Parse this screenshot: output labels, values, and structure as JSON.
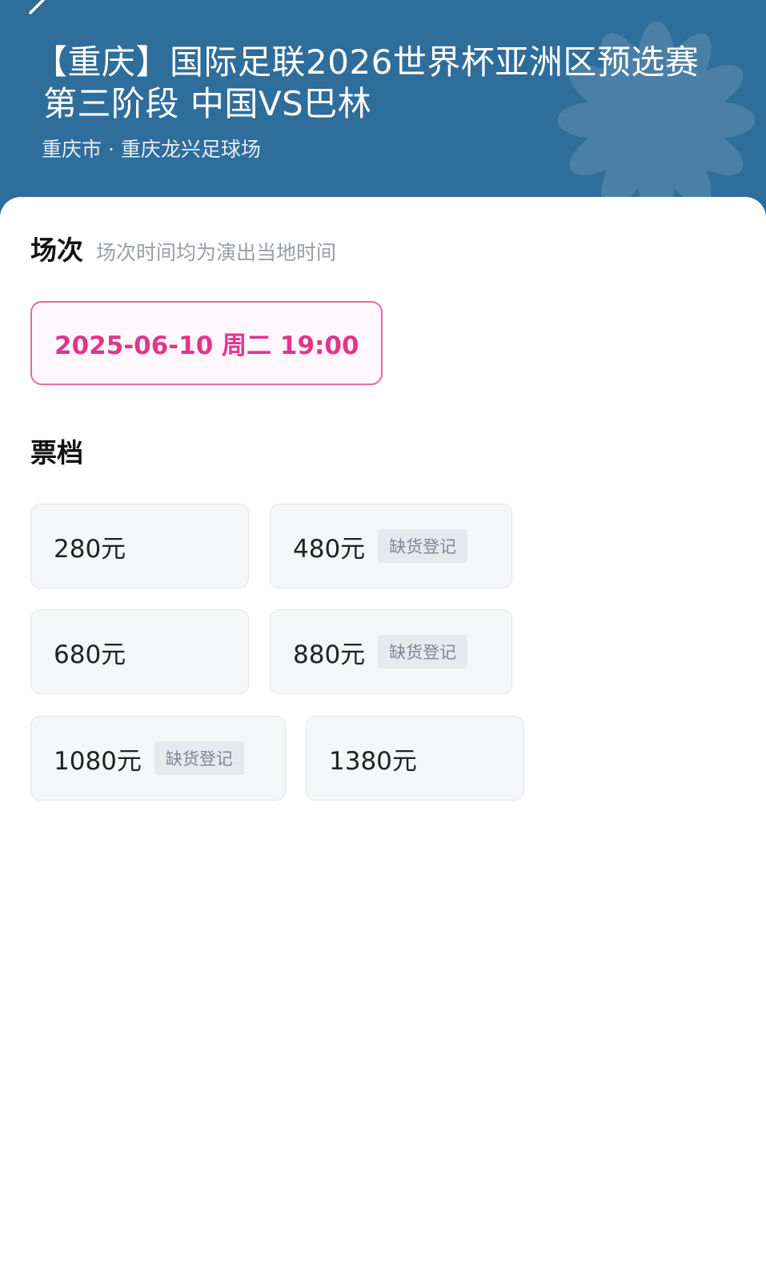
{
  "header": {
    "title_line1": "【重庆】国际足联2026世界杯亚洲区预选赛",
    "title_line2": "第三阶段 中国VS巴林",
    "venue": "重庆市 · 重庆龙兴足球场",
    "icons": [
      "back-arrow-icon",
      "flower-decoration-icon"
    ],
    "bg_color": "#2f6d9b"
  },
  "session": {
    "title": "场次",
    "subtitle": "场次时间均为演出当地时间",
    "options": [
      {
        "label": "2025-06-10  周二 19:00",
        "selected": true
      }
    ],
    "accent_color": "#e0358a"
  },
  "tiers": {
    "title": "票档",
    "items": [
      {
        "price": "280元",
        "tag": ""
      },
      {
        "price": "480元",
        "tag": "缺货登记"
      },
      {
        "price": "680元",
        "tag": ""
      },
      {
        "price": "880元",
        "tag": "缺货登记"
      },
      {
        "price": "1080元",
        "tag": "缺货登记"
      },
      {
        "price": "1380元",
        "tag": ""
      }
    ]
  }
}
